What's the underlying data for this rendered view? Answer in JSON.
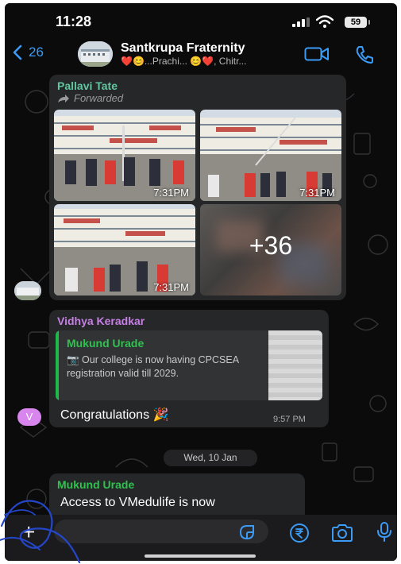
{
  "status_bar": {
    "time": "11:28",
    "battery": "59"
  },
  "header": {
    "back_count": "26",
    "title": "Santkrupa Fraternity",
    "subtitle": "❤️😊...Prachi... 😊❤️, Chitr..."
  },
  "messages": [
    {
      "sender": "Pallavi Tate",
      "sender_color": "#5fc8a0",
      "forwarded_label": "Forwarded",
      "photos": [
        {
          "time": "7:31PM"
        },
        {
          "time": "7:31PM"
        },
        {
          "time": "7:31PM"
        }
      ],
      "more_count": "+36"
    },
    {
      "sender": "Vidhya Keradkar",
      "sender_color": "#c77fe6",
      "avatar_letter": "V",
      "quote": {
        "author": "Mukund Urade",
        "text": "📷 Our college is now having CPCSEA registration valid till 2029."
      },
      "text": "Congratulations 🎉",
      "time": "9:57 PM"
    },
    {
      "sender": "Mukund Urade",
      "sender_color": "#2fc24f",
      "text": "Access to VMedulife is now"
    }
  ],
  "date_divider": "Wed, 10 Jan",
  "composer": {
    "placeholder": ""
  },
  "colors": {
    "accent": "#3b9bf5",
    "bubble": "#262729",
    "background": "#0b0b0c"
  }
}
